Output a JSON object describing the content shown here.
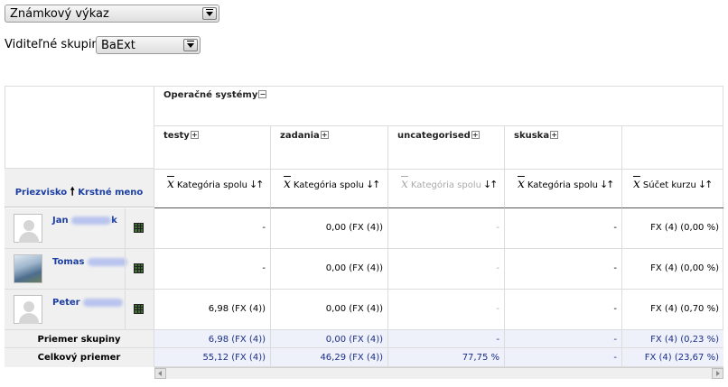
{
  "report_select": {
    "value": "Známkový výkaz"
  },
  "groups": {
    "label": "Viditeľné skupiny",
    "value": "BaExt"
  },
  "table": {
    "category_title": "Operačné systémy",
    "columns": [
      {
        "name": "testy",
        "aggregate": "Kategória spolu"
      },
      {
        "name": "zadania",
        "aggregate": "Kategória spolu"
      },
      {
        "name": "uncategorised",
        "aggregate": "Kategória spolu"
      },
      {
        "name": "skuska",
        "aggregate": "Kategória spolu"
      },
      {
        "name": "",
        "aggregate": "Súčet kurzu"
      }
    ],
    "name_header": {
      "surname": "Priezvisko",
      "firstname": "Krstné meno"
    },
    "rows": [
      {
        "name": "Jan",
        "name_suffix": "k",
        "values": [
          "-",
          "0,00 (FX (4))",
          "-",
          "-",
          "FX (4) (0,00 %)"
        ]
      },
      {
        "name": "Tomas",
        "name_suffix": "",
        "values": [
          "-",
          "0,00 (FX (4))",
          "-",
          "-",
          "FX (4) (0,00 %)"
        ]
      },
      {
        "name": "Peter",
        "name_suffix": "",
        "values": [
          "6,98 (FX (4))",
          "0,00 (FX (4))",
          "-",
          "-",
          "FX (4) (0,70 %)"
        ]
      }
    ],
    "group_average": {
      "label": "Priemer skupiny",
      "values": [
        "6,98 (FX (4))",
        "0,00 (FX (4))",
        "-",
        "-",
        "FX (4) (0,23 %)"
      ]
    },
    "overall_average": {
      "label": "Celkový priemer",
      "values": [
        "55,12 (FX (4))",
        "46,29 (FX (4))",
        "77,75 %",
        "-",
        "FX (4) (23,67 %)"
      ]
    }
  },
  "colors": {
    "link": "#1b3ea3",
    "avg_row": "#eef0fa",
    "left_header": "#f0f0f0"
  }
}
